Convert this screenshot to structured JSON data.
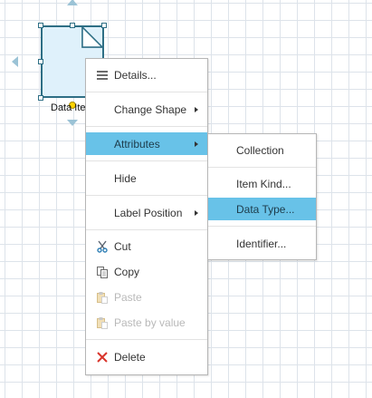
{
  "canvas": {
    "shape_label": "Data Ite"
  },
  "context_menu": {
    "items": [
      {
        "label": "Details...",
        "icon": "list-icon",
        "enabled": true
      },
      {
        "label": "Change Shape",
        "has_submenu": true,
        "enabled": true
      },
      {
        "label": "Attributes",
        "has_submenu": true,
        "enabled": true,
        "highlighted": true
      },
      {
        "label": "Hide",
        "enabled": true
      },
      {
        "label": "Label Position",
        "has_submenu": true,
        "enabled": true
      },
      {
        "label": "Cut",
        "icon": "scissors-icon",
        "enabled": true
      },
      {
        "label": "Copy",
        "icon": "copy-icon",
        "enabled": true
      },
      {
        "label": "Paste",
        "icon": "paste-icon",
        "enabled": false
      },
      {
        "label": "Paste by value",
        "icon": "paste-icon",
        "enabled": false
      },
      {
        "label": "Delete",
        "icon": "delete-x-icon",
        "enabled": true
      }
    ]
  },
  "attributes_submenu": {
    "items": [
      {
        "label": "Collection"
      },
      {
        "label": "Item Kind..."
      },
      {
        "label": "Data Type...",
        "highlighted": true
      },
      {
        "label": "Identifier..."
      }
    ]
  },
  "colors": {
    "highlight": "#68c2e8",
    "shape_fill": "#dff1fb",
    "shape_stroke": "#2e6f85",
    "delete_red": "#d9342b"
  }
}
